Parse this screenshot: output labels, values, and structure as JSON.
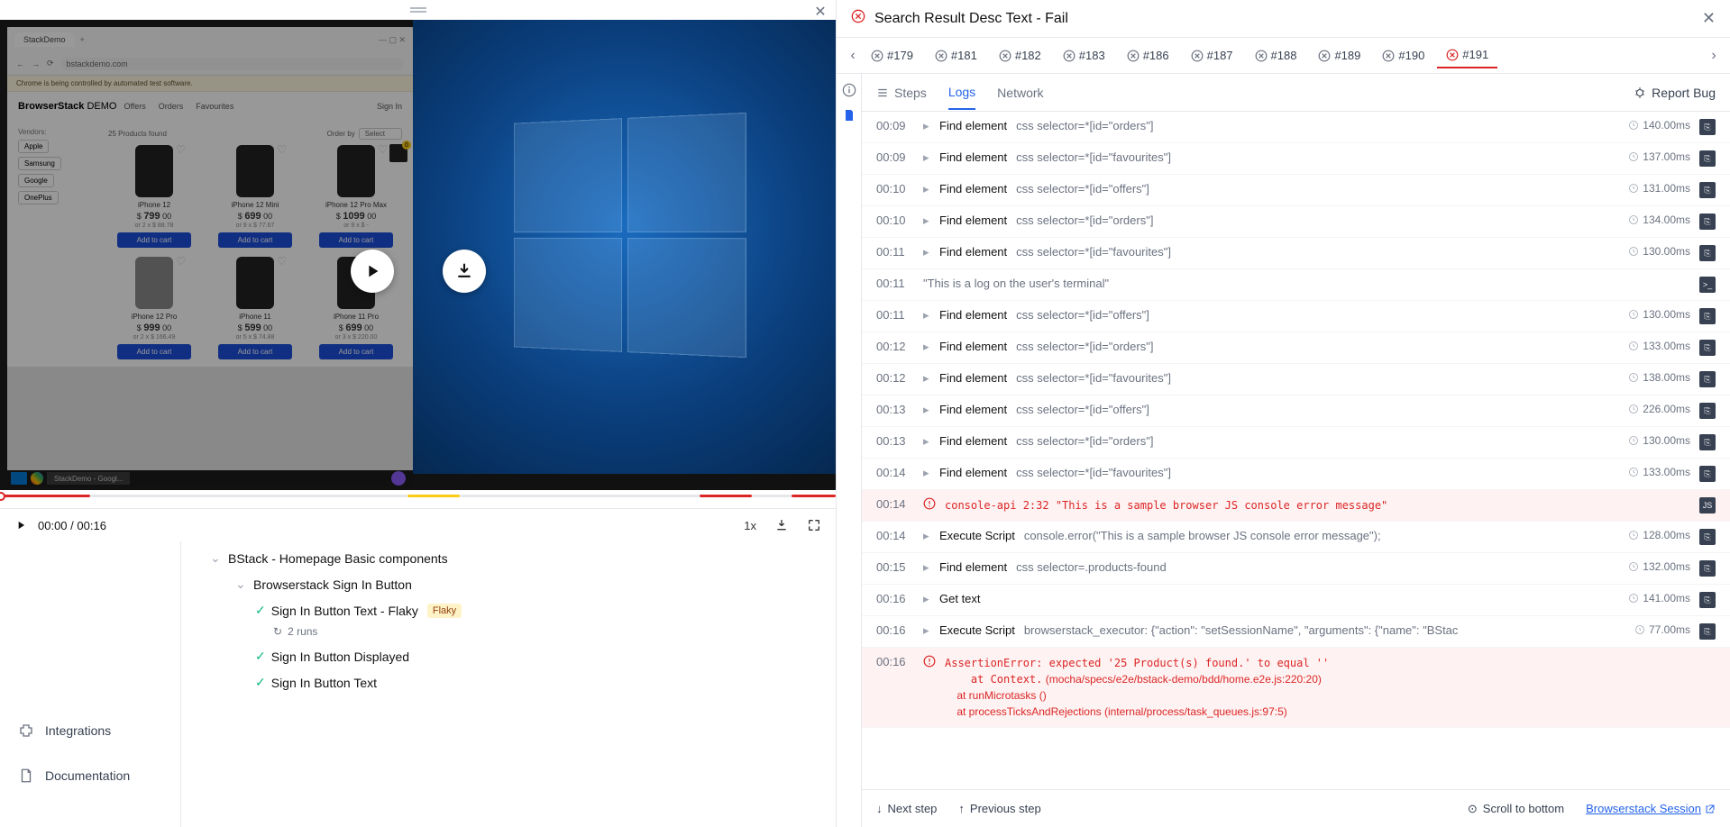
{
  "header": {
    "title": "Search Result Desc Text - Fail"
  },
  "runTabs": [
    {
      "id": "#179",
      "status": "fail"
    },
    {
      "id": "#181",
      "status": "fail"
    },
    {
      "id": "#182",
      "status": "fail"
    },
    {
      "id": "#183",
      "status": "fail"
    },
    {
      "id": "#186",
      "status": "fail"
    },
    {
      "id": "#187",
      "status": "fail"
    },
    {
      "id": "#188",
      "status": "fail"
    },
    {
      "id": "#189",
      "status": "fail"
    },
    {
      "id": "#190",
      "status": "fail"
    },
    {
      "id": "#191",
      "status": "fail",
      "active": true
    }
  ],
  "subTabs": {
    "steps": "Steps",
    "logs": "Logs",
    "network": "Network",
    "reportBug": "Report Bug"
  },
  "video": {
    "currentTime": "00:00",
    "duration": "00:16",
    "speed": "1x"
  },
  "tree": {
    "item1": "BStack - Homepage Basic components",
    "item2": "Browserstack Sign In Button",
    "item3": "Sign In Button Text - Flaky",
    "item3_badge": "Flaky",
    "item3_runs": "2 runs",
    "item4": "Sign In Button Displayed",
    "item5": "Sign In Button Text"
  },
  "sidebar": {
    "integrations": "Integrations",
    "documentation": "Documentation"
  },
  "logs": [
    {
      "time": "00:09",
      "cmd": "Find element",
      "detail": "css selector=*[id=\"orders\"]",
      "dur": "140.00ms"
    },
    {
      "time": "00:09",
      "cmd": "Find element",
      "detail": "css selector=*[id=\"favourites\"]",
      "dur": "137.00ms"
    },
    {
      "time": "00:10",
      "cmd": "Find element",
      "detail": "css selector=*[id=\"offers\"]",
      "dur": "131.00ms"
    },
    {
      "time": "00:10",
      "cmd": "Find element",
      "detail": "css selector=*[id=\"orders\"]",
      "dur": "134.00ms"
    },
    {
      "time": "00:11",
      "cmd": "Find element",
      "detail": "css selector=*[id=\"favourites\"]",
      "dur": "130.00ms"
    },
    {
      "time": "00:11",
      "cmd": "",
      "detail": "\"This is a log on the user's terminal\"",
      "dur": "",
      "terminal": true
    },
    {
      "time": "00:11",
      "cmd": "Find element",
      "detail": "css selector=*[id=\"offers\"]",
      "dur": "130.00ms"
    },
    {
      "time": "00:12",
      "cmd": "Find element",
      "detail": "css selector=*[id=\"orders\"]",
      "dur": "133.00ms"
    },
    {
      "time": "00:12",
      "cmd": "Find element",
      "detail": "css selector=*[id=\"favourites\"]",
      "dur": "138.00ms"
    },
    {
      "time": "00:13",
      "cmd": "Find element",
      "detail": "css selector=*[id=\"offers\"]",
      "dur": "226.00ms"
    },
    {
      "time": "00:13",
      "cmd": "Find element",
      "detail": "css selector=*[id=\"orders\"]",
      "dur": "130.00ms"
    },
    {
      "time": "00:14",
      "cmd": "Find element",
      "detail": "css selector=*[id=\"favourites\"]",
      "dur": "133.00ms"
    },
    {
      "time": "00:14",
      "cmd": "",
      "detail": "console-api 2:32 \"This is a sample browser JS console error message\"",
      "error": true,
      "jsbadge": true
    },
    {
      "time": "00:14",
      "cmd": "Execute Script",
      "detail": "console.error(\"This is a sample browser JS console error message\");",
      "dur": "128.00ms"
    },
    {
      "time": "00:15",
      "cmd": "Find element",
      "detail": "css selector=.products-found",
      "dur": "132.00ms"
    },
    {
      "time": "00:16",
      "cmd": "Get text",
      "detail": "",
      "dur": "141.00ms"
    },
    {
      "time": "00:16",
      "cmd": "Execute Script",
      "detail": "browserstack_executor: {\"action\": \"setSessionName\", \"arguments\": {\"name\": \"BStac",
      "dur": "77.00ms"
    },
    {
      "time": "00:16",
      "cmd": "",
      "detail": "AssertionError: expected '25 Product(s) found.' to equal ''\n    at Context.<anonymous> (mocha/specs/e2e/bstack-demo/bdd/home.e2e.js:220:20)\n    at runMicrotasks (<anonymous>)\n    at processTicksAndRejections (internal/process/task_queues.js:97:5)",
      "error": true
    }
  ],
  "footer": {
    "next": "Next step",
    "prev": "Previous step",
    "scroll": "Scroll to bottom",
    "session": "Browserstack Session"
  },
  "screenshot": {
    "tabTitle": "StackDemo",
    "url": "bstackdemo.com",
    "notice": "Chrome is being controlled by automated test software.",
    "logo1": "BrowserStack",
    "logo2": "DEMO",
    "nav": {
      "offers": "Offers",
      "orders": "Orders",
      "favourites": "Favourites"
    },
    "signin": "Sign In",
    "vendorsLabel": "Vendors:",
    "vendors": [
      "Apple",
      "Samsung",
      "Google",
      "OnePlus"
    ],
    "productsFound": "25 Products found",
    "orderBy": "Order by",
    "select": "Select",
    "products": [
      {
        "name": "iPhone 12",
        "price": "799",
        "sub": "or 2 x $ 88.78"
      },
      {
        "name": "iPhone 12 Mini",
        "price": "699",
        "sub": "or 9 x $ 77.67"
      },
      {
        "name": "iPhone 12 Pro Max",
        "price": "1099",
        "sub": "or 9 x $ -"
      },
      {
        "name": "iPhone 12 Pro",
        "price": "999",
        "sub": "or 2 x $ 166.49"
      },
      {
        "name": "iPhone 11",
        "price": "599",
        "sub": "or 5 x $ 74.88"
      },
      {
        "name": "iPhone 11 Pro",
        "price": "699",
        "sub": "or 3 x $ 220.00"
      }
    ],
    "addToCart": "Add to cart",
    "taskbarApp": "StackDemo - Googl..."
  }
}
